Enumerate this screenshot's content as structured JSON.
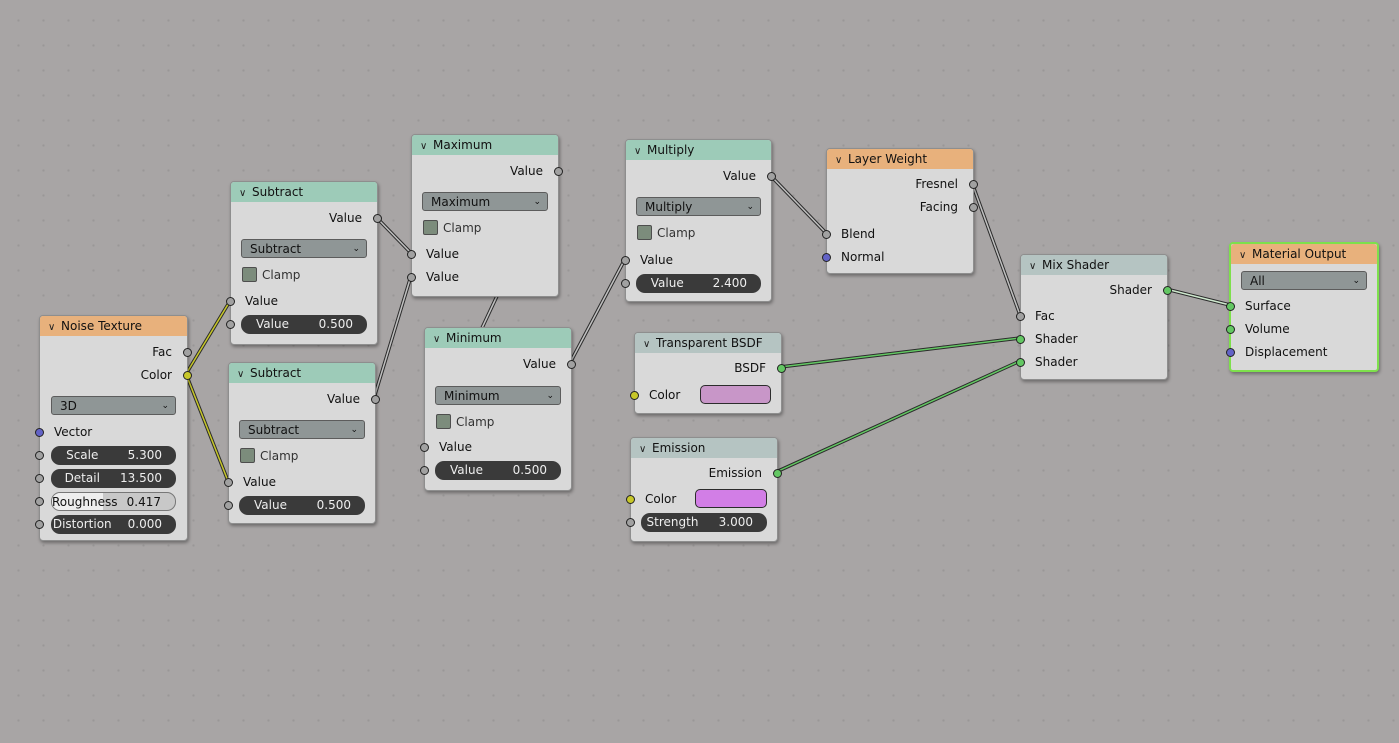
{
  "nodes": {
    "noise": {
      "title": "Noise Texture",
      "out_fac": "Fac",
      "out_color": "Color",
      "dimension": "3D",
      "in_vector": "Vector",
      "scale_label": "Scale",
      "scale_value": "5.300",
      "detail_label": "Detail",
      "detail_value": "13.500",
      "roughness_label": "Roughness",
      "roughness_value": "0.417",
      "roughness_fraction": 0.417,
      "distortion_label": "Distortion",
      "distortion_value": "0.000"
    },
    "sub1": {
      "title": "Subtract",
      "out_value": "Value",
      "op": "Subtract",
      "clamp": "Clamp",
      "in_value": "Value",
      "field_label": "Value",
      "field_value": "0.500"
    },
    "sub2": {
      "title": "Subtract",
      "out_value": "Value",
      "op": "Subtract",
      "clamp": "Clamp",
      "in_value": "Value",
      "field_label": "Value",
      "field_value": "0.500"
    },
    "max": {
      "title": "Maximum",
      "out_value": "Value",
      "op": "Maximum",
      "clamp": "Clamp",
      "in_value1": "Value",
      "in_value2": "Value"
    },
    "min": {
      "title": "Minimum",
      "out_value": "Value",
      "op": "Minimum",
      "clamp": "Clamp",
      "in_value": "Value",
      "field_label": "Value",
      "field_value": "0.500"
    },
    "mul": {
      "title": "Multiply",
      "out_value": "Value",
      "op": "Multiply",
      "clamp": "Clamp",
      "in_value": "Value",
      "field_label": "Value",
      "field_value": "2.400"
    },
    "layer": {
      "title": "Layer Weight",
      "out_fresnel": "Fresnel",
      "out_facing": "Facing",
      "in_blend": "Blend",
      "in_normal": "Normal"
    },
    "transp": {
      "title": "Transparent BSDF",
      "out_bsdf": "BSDF",
      "in_color": "Color",
      "color": "#c896c8"
    },
    "emis": {
      "title": "Emission",
      "out_emission": "Emission",
      "in_color": "Color",
      "color": "#d27ee6",
      "strength_label": "Strength",
      "strength_value": "3.000"
    },
    "mix": {
      "title": "Mix Shader",
      "out_shader": "Shader",
      "in_fac": "Fac",
      "in_shader1": "Shader",
      "in_shader2": "Shader"
    },
    "out": {
      "title": "Material Output",
      "target": "All",
      "in_surface": "Surface",
      "in_volume": "Volume",
      "in_displacement": "Displacement"
    }
  },
  "colors": {
    "header_converter": "#9dcbb8",
    "header_input": "#e8b17c",
    "header_shader": "#b5c4c2",
    "socket_float": "#a1a1a1",
    "socket_color": "#c7c729",
    "socket_vector": "#6363c7",
    "socket_shader": "#63c763",
    "selected_outline": "#7ee04c"
  }
}
